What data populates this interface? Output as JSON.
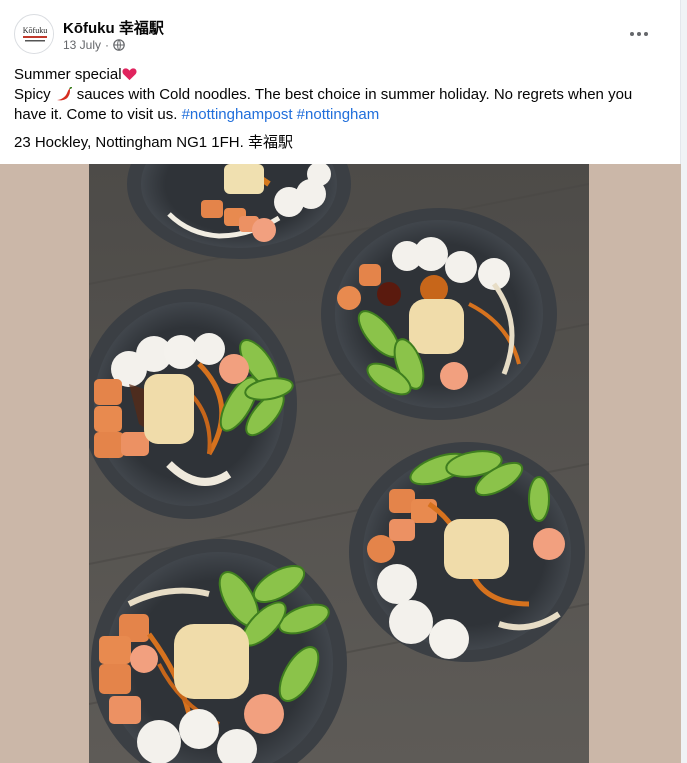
{
  "post": {
    "page_name": "Kōfuku 幸福駅",
    "date": "13 July",
    "separator": "·",
    "privacy_icon": "globe-icon",
    "more_icon": "more-options-icon",
    "avatar": {
      "logo_text": "Kōfuku",
      "logo_icon": "kofuku-logo"
    },
    "text": {
      "line1": "Summer special",
      "line1_emoji": "heart-icon",
      "line2_start": "Spicy",
      "line2_emoji": "chili-icon",
      "line2_rest": "sauces with Cold noodles. The best choice in summer holiday. No regrets when you have it. Come to visit us.",
      "hashtag1": "#nottinghampost",
      "hashtag2": "#nottingham"
    },
    "address": "23 Hockley, Nottingham NG1 1FH. 幸福駅"
  },
  "photo": {
    "subject": "photo-bowls-cold-noodles",
    "colors": {
      "table": "#5a5753",
      "bowl": "#3b3f44",
      "frame": "#cbb7a8"
    }
  }
}
